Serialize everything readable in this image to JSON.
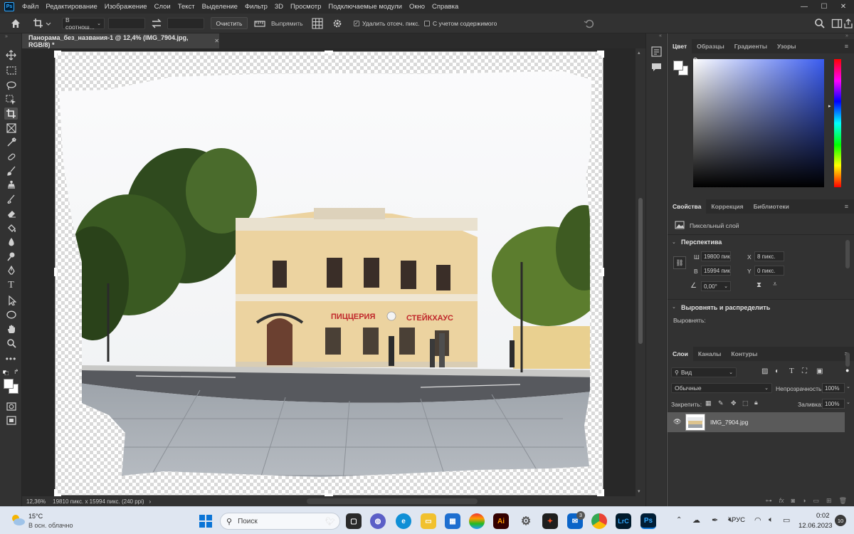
{
  "app": {
    "logo": "Ps"
  },
  "menu": [
    "Файл",
    "Редактирование",
    "Изображение",
    "Слои",
    "Текст",
    "Выделение",
    "Фильтр",
    "3D",
    "Просмотр",
    "Подключаемые модули",
    "Окно",
    "Справка"
  ],
  "window_controls": {
    "minimize": "—",
    "maximize": "☐",
    "close": "✕"
  },
  "options_bar": {
    "ratio_select": "В соотнош...",
    "clear_button": "Очистить",
    "straighten_label": "Выпрямить",
    "delete_cropped_label": "Удалить отсеч. пикс.",
    "delete_cropped_checked": true,
    "content_aware_label": "С учетом содержимого",
    "content_aware_checked": false
  },
  "document": {
    "tab_title": "Панорама_без_названия-1 @ 12,4% (IMG_7904.jpg, RGB/8) *",
    "tab_close": "✕"
  },
  "status_bar": {
    "zoom": "12,36%",
    "doc_info": "19810 пикс. x 15994 пикс. (240 ppi)",
    "arrow": "›"
  },
  "color_panel": {
    "tabs": [
      "Цвет",
      "Образцы",
      "Градиенты",
      "Узоры"
    ],
    "active_tab": "Цвет",
    "picker_hue": "#3a5cf0"
  },
  "properties_panel": {
    "tabs": [
      "Свойства",
      "Коррекция",
      "Библиотеки"
    ],
    "layer_type": "Пиксельный слой",
    "section_perspective": "Перспектива",
    "w_label": "Ш",
    "w_value": "19800 пик",
    "h_label": "В",
    "h_value": "15994 пик",
    "x_label": "X",
    "x_value": "8 пикс.",
    "y_label": "Y",
    "y_value": "0 пикс.",
    "angle_value": "0,00°",
    "section_align": "Выровнять и распределить",
    "align_label": "Выровнять:"
  },
  "layers_panel": {
    "tabs": [
      "Слои",
      "Каналы",
      "Контуры"
    ],
    "filter_kind": "Вид",
    "blend_mode": "Обычные",
    "opacity_label": "Непрозрачность:",
    "opacity_value": "100%",
    "lock_label": "Закрепить:",
    "fill_label": "Заливка:",
    "fill_value": "100%",
    "layer_name": "IMG_7904.jpg"
  },
  "photo": {
    "sign_left": "ПИЦЦЕРИЯ",
    "sign_right": "СТЕЙКХАУС"
  },
  "taskbar": {
    "weather_temp": "15°C",
    "weather_desc": "В осн. облачно",
    "search_placeholder": "Поиск",
    "lang": "РУС",
    "time": "0:02",
    "date": "12.06.2023",
    "notification_count": "10",
    "mail_badge": "3"
  }
}
